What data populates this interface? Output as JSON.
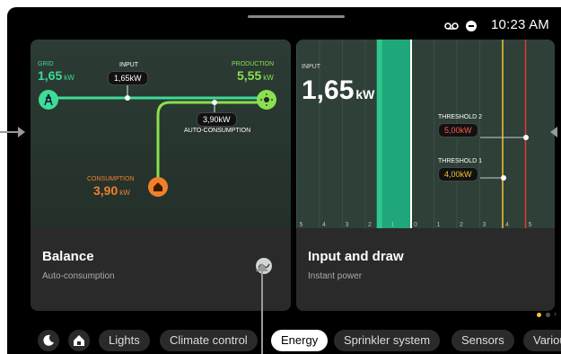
{
  "status": {
    "time": "10:23 AM",
    "voicemail_icon": "voicemail-icon",
    "dnd_icon": "do-not-disturb-icon"
  },
  "balance_card": {
    "title": "Balance",
    "subtitle": "Auto-consumption",
    "grid": {
      "label": "GRID",
      "value": "1,65",
      "unit": "kW",
      "color": "#3ddc97"
    },
    "input": {
      "label": "INPUT",
      "value": "1,65",
      "unit": "kW"
    },
    "production": {
      "label": "PRODUCTION",
      "value": "5,55",
      "unit": "kW",
      "color": "#8be04e"
    },
    "auto_consumption": {
      "label": "AUTO-CONSUMPTION",
      "value": "3,90",
      "unit": "kW"
    },
    "consumption": {
      "label": "CONSUMPTION",
      "value": "3,90",
      "unit": "kW",
      "color": "#f0802a"
    },
    "icon": "balance-icon"
  },
  "input_card": {
    "title": "Input and draw",
    "subtitle": "Instant power",
    "input_label": "INPUT",
    "input_value": "1,65",
    "input_unit": "kW",
    "threshold2": {
      "label": "THRESHOLD 2",
      "value": "5,00",
      "unit": "kW",
      "color": "#e53935"
    },
    "threshold1": {
      "label": "THRESHOLD 1",
      "value": "4,00",
      "unit": "kW",
      "color": "#f4c430"
    },
    "scale": [
      "5",
      "4",
      "3",
      "2",
      "1",
      "0",
      "1",
      "2",
      "3",
      "4",
      "5"
    ],
    "bar_from": 0,
    "bar_to": 1.65
  },
  "nav": {
    "items": [
      "Lights",
      "Climate control",
      "Energy",
      "Sprinkler system",
      "Sensors",
      "Various"
    ],
    "active": "Energy",
    "night_icon": "moon-icon",
    "home_icon": "home-icon"
  }
}
